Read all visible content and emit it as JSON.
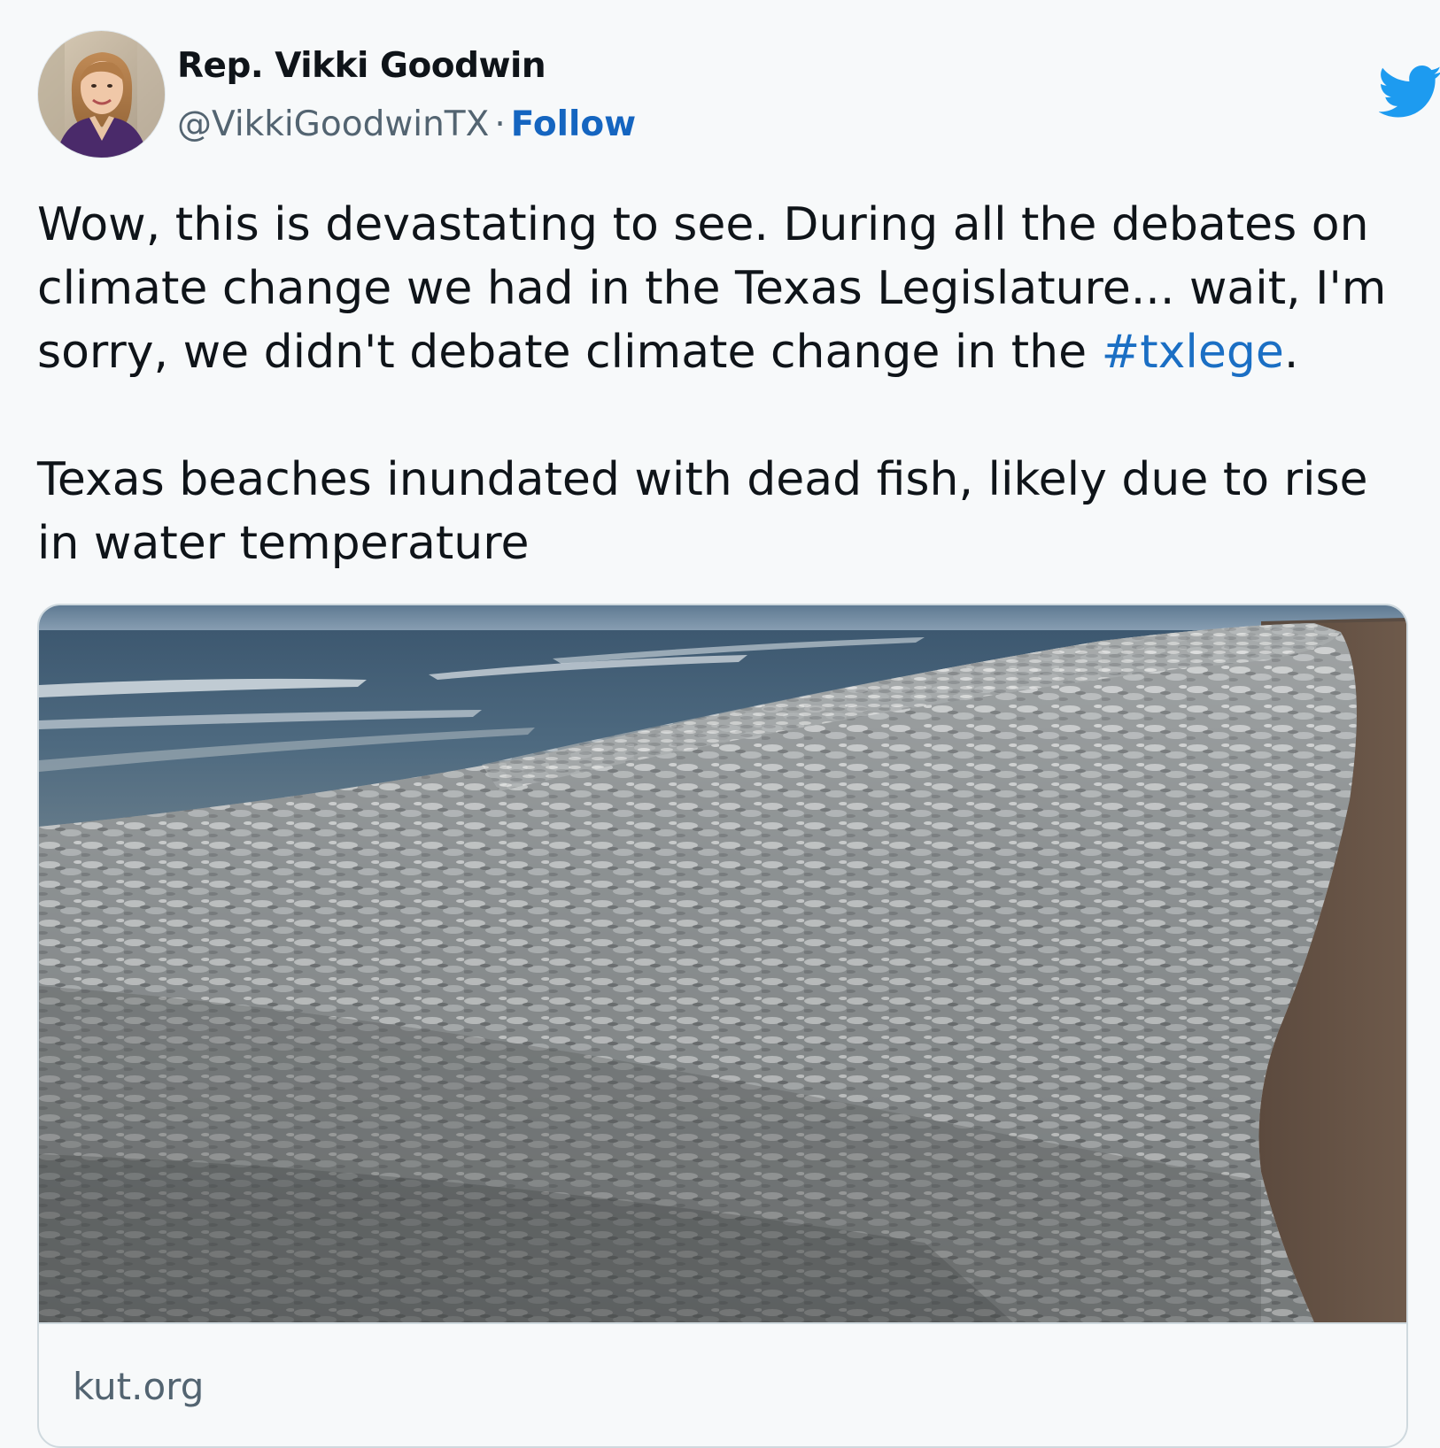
{
  "author": {
    "display_name": "Rep. Vikki Goodwin",
    "handle": "@VikkiGoodwinTX",
    "separator": "·",
    "follow_label": "Follow"
  },
  "tweet": {
    "para1_text": "Wow, this is devastating to see. During all the debates on climate change we had in the Texas Legislature... wait, I'm sorry, we didn't debate climate change in the ",
    "hashtag": "#txlege",
    "para1_end": ".",
    "para2_text": "Texas beaches inundated with dead fish, likely due to rise in water temperature"
  },
  "card": {
    "domain": "kut.org"
  },
  "colors": {
    "link": "#1b6fc4",
    "twitter_blue": "#1d9bf0",
    "muted": "#536471"
  },
  "icons": {
    "logo": "twitter-bird-icon"
  }
}
